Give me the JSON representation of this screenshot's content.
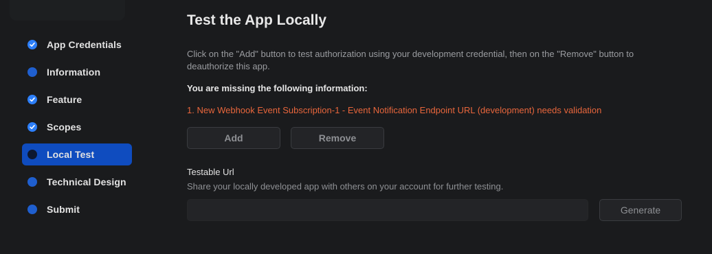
{
  "sidebar": {
    "items": [
      {
        "label": "App Credentials",
        "status": "done"
      },
      {
        "label": "Information",
        "status": "todo"
      },
      {
        "label": "Feature",
        "status": "done"
      },
      {
        "label": "Scopes",
        "status": "done"
      },
      {
        "label": "Local Test",
        "status": "current"
      },
      {
        "label": "Technical Design",
        "status": "todo"
      },
      {
        "label": "Submit",
        "status": "todo"
      }
    ]
  },
  "main": {
    "title": "Test the App Locally",
    "description": "Click on the \"Add\" button to test authorization using your development credential, then on the \"Remove\" button to deauthorize this app.",
    "missing_title": "You are missing the following information:",
    "missing_items": [
      "1. New Webhook Event Subscription-1 - Event Notification Endpoint URL (development) needs validation"
    ],
    "add_label": "Add",
    "remove_label": "Remove",
    "testable_url": {
      "label": "Testable Url",
      "help": "Share your locally developed app with others on your account for further testing.",
      "value": "",
      "generate_label": "Generate"
    }
  },
  "colors": {
    "background": "#1a1b1d",
    "accent": "#0f4cbf",
    "check": "#2d7ff9",
    "warning": "#e8663c"
  }
}
